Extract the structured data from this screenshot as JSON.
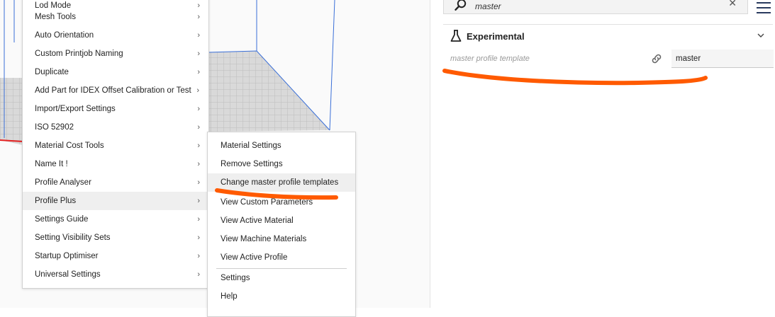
{
  "main_menu": {
    "items": [
      {
        "label": "Lod Mode",
        "has_submenu": true
      },
      {
        "label": "Mesh Tools",
        "has_submenu": true
      },
      {
        "label": "Auto Orientation",
        "has_submenu": true
      },
      {
        "label": "Custom Printjob Naming",
        "has_submenu": true
      },
      {
        "label": "Duplicate",
        "has_submenu": true
      },
      {
        "label": "Add Part for IDEX Offset Calibration or Test",
        "has_submenu": true
      },
      {
        "label": "Import/Export Settings",
        "has_submenu": true
      },
      {
        "label": "ISO 52902",
        "has_submenu": true
      },
      {
        "label": "Material Cost Tools",
        "has_submenu": true
      },
      {
        "label": "Name It !",
        "has_submenu": true
      },
      {
        "label": "Profile Analyser",
        "has_submenu": true
      },
      {
        "label": "Profile Plus",
        "has_submenu": true,
        "highlighted": true
      },
      {
        "label": "Settings Guide",
        "has_submenu": true
      },
      {
        "label": "Setting Visibility Sets",
        "has_submenu": true
      },
      {
        "label": "Startup Optimiser",
        "has_submenu": true
      },
      {
        "label": "Universal Settings",
        "has_submenu": true
      }
    ],
    "arrow": "›"
  },
  "sub_menu": {
    "group1": [
      {
        "label": "Material Settings"
      },
      {
        "label": "Remove Settings"
      },
      {
        "label": "Change master profile templates",
        "highlighted": true
      },
      {
        "label": "View Custom Parameters"
      },
      {
        "label": "View Active Material"
      },
      {
        "label": "View Machine Materials"
      },
      {
        "label": "View Active Profile"
      }
    ],
    "group2": [
      {
        "label": "Settings"
      },
      {
        "label": "Help"
      }
    ]
  },
  "panel": {
    "search": {
      "value": "master",
      "clear": "✕"
    },
    "category": {
      "title": "Experimental"
    },
    "setting": {
      "label": "master profile template",
      "value": "master"
    }
  },
  "colors": {
    "annotation": "#ff5a00",
    "bed_edge": "#3a6fd8",
    "axis_red": "#e52222"
  }
}
